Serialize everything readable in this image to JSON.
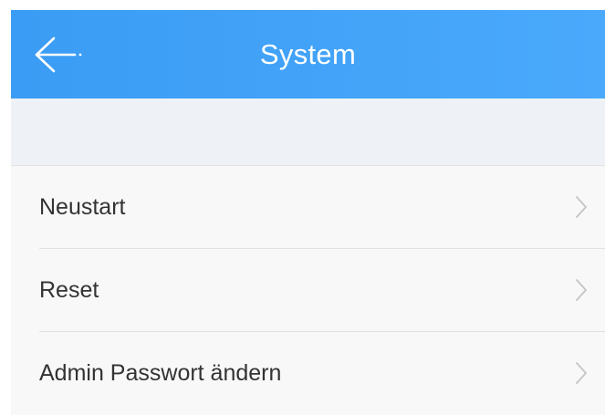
{
  "header": {
    "back_icon": "arrow-left-icon",
    "title": "System",
    "background_color": "#3a9cf4"
  },
  "menu": {
    "items": [
      {
        "label": "Neustart",
        "icon": "chevron-right-icon"
      },
      {
        "label": "Reset",
        "icon": "chevron-right-icon"
      },
      {
        "label": "Admin Passwort ändern",
        "icon": "chevron-right-icon"
      }
    ]
  }
}
